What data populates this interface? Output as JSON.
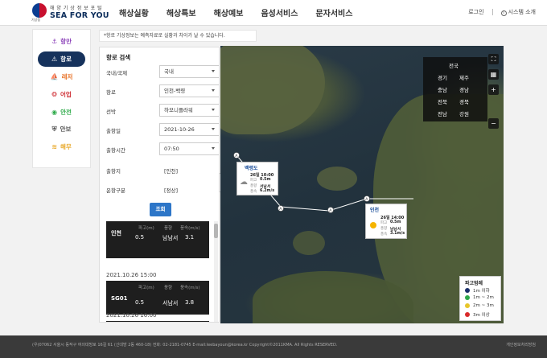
{
  "header": {
    "logo_sub": "해 양 기 상 정 보 포 털",
    "logo_main": "SEA FOR YOU",
    "emblem_label": "기상청",
    "nav": [
      "해상실황",
      "해상특보",
      "해상예보",
      "음성서비스",
      "문자서비스"
    ],
    "login": "로그인",
    "system_intro": "시스템 소개"
  },
  "sidebar": {
    "items": [
      {
        "label": "항만",
        "icon": "⚓",
        "color": "#8a3fb8"
      },
      {
        "label": "항로",
        "icon": "⚠",
        "color": "#ffffff"
      },
      {
        "label": "레저",
        "icon": "⛵",
        "color": "#e8742a"
      },
      {
        "label": "어업",
        "icon": "🐟",
        "color": "#d0343a"
      },
      {
        "label": "안전",
        "icon": "📶",
        "color": "#2eaa4a"
      },
      {
        "label": "안보",
        "icon": "🛡",
        "color": "#555555"
      },
      {
        "label": "해무",
        "icon": "≋",
        "color": "#e8a82a"
      }
    ]
  },
  "notice": "*항로 기상정보는 예측자료로 실황과 차이가 날 수 있습니다.",
  "search": {
    "title": "항로 검색",
    "fields": [
      {
        "label": "국내/국제",
        "value": "국내",
        "type": "select"
      },
      {
        "label": "항로",
        "value": "인천-백령",
        "type": "select"
      },
      {
        "label": "선박",
        "value": "하모니플라워",
        "type": "select"
      },
      {
        "label": "출항일",
        "value": "2021-10-26",
        "type": "select"
      },
      {
        "label": "출항시간",
        "value": "07:50",
        "type": "select"
      },
      {
        "label": "출항지",
        "value": "[인천]",
        "type": "text"
      },
      {
        "label": "운항구분",
        "value": "[정상]",
        "type": "text"
      }
    ],
    "button": "조회"
  },
  "results": {
    "headers": [
      "파고(m)",
      "풍향",
      "풍속(m/s)"
    ],
    "cards": [
      {
        "time": "",
        "station": "인천",
        "wave": "0.5",
        "dir": "남남서",
        "speed": "3.1"
      },
      {
        "time": "2021.10.26 15:00",
        "station": "SG01",
        "wave": "0.5",
        "dir": "서남서",
        "speed": "3.8"
      },
      {
        "time": "2021.10.26 16:00",
        "station": "",
        "wave": "",
        "dir": "",
        "speed": ""
      }
    ]
  },
  "map": {
    "regions": [
      "전국",
      "경기",
      "제주",
      "충남",
      "경남",
      "전북",
      "경북",
      "전남",
      "강원"
    ],
    "popups": [
      {
        "name": "백령도",
        "time": "26일 10:00",
        "wave_label": "파고",
        "wave": "0.5m",
        "dir_label": "풍향",
        "dir": "서남서",
        "speed_label": "풍속",
        "speed": "6.2m/s",
        "weather": "cloudy"
      },
      {
        "name": "인천",
        "time": "26일 14:00",
        "wave_label": "파고",
        "wave": "0.5m",
        "dir_label": "풍향",
        "dir": "남남서",
        "speed_label": "풍속",
        "speed": "3.1m/s",
        "weather": "sunny"
      }
    ],
    "legend": {
      "title": "파고범례",
      "items": [
        {
          "label": "1m 이하",
          "color": "#1b2f6b"
        },
        {
          "label": "1m ~ 2m",
          "color": "#2ea84a"
        },
        {
          "label": "2m ~ 3m",
          "color": "#e8c62a"
        },
        {
          "label": "3m 이상",
          "color": "#d92a2a"
        }
      ]
    },
    "route_markers": [
      "A",
      "A",
      "A",
      "A"
    ]
  },
  "footer": {
    "left": "(우)07062 서울시 동작구 여의대방로 16길 61 (신대방 2동 460-18)    전화: 02-2181-0745    E-mail:leebayoun@korea.kr    Copyright©2011KMA. All Rights RESERVED.",
    "right": "개인정보처리방침"
  }
}
